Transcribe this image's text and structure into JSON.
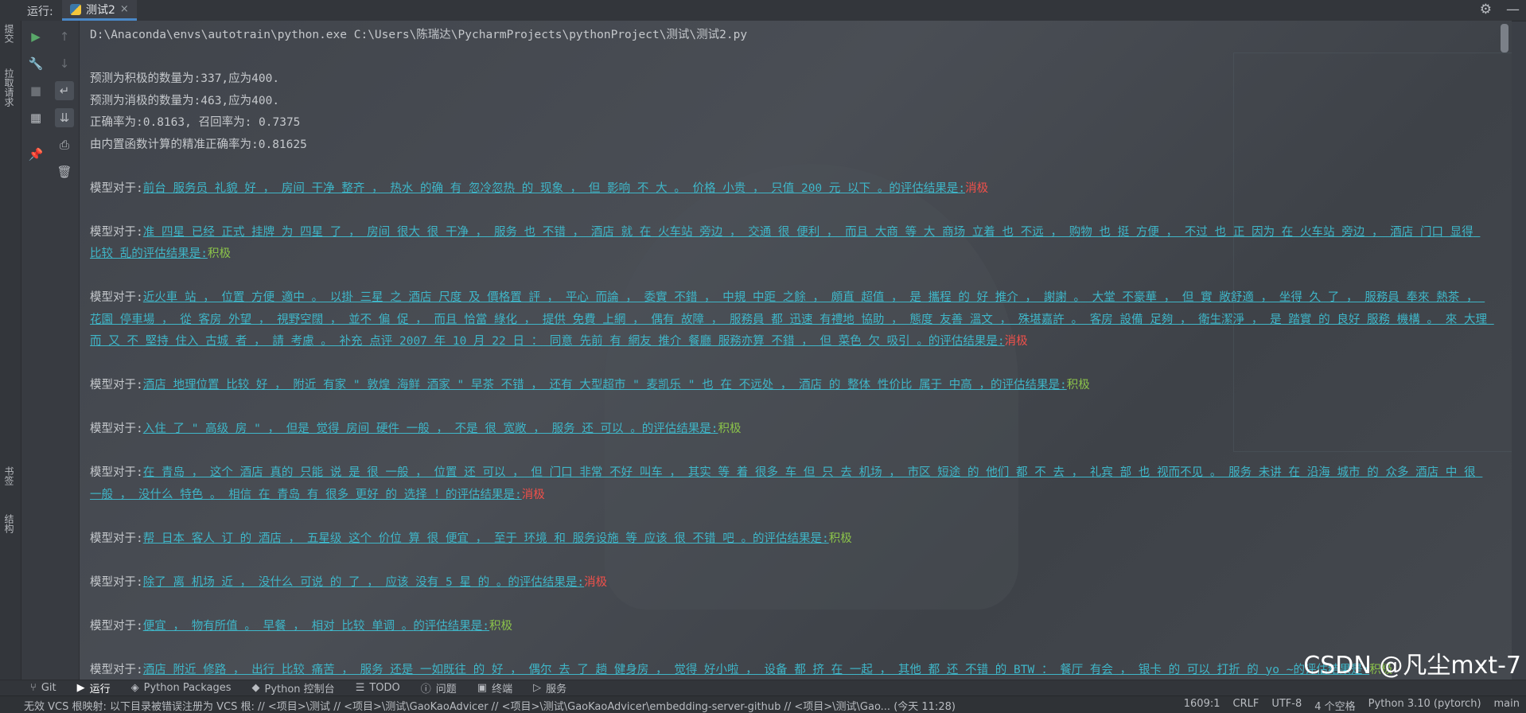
{
  "topbar": {
    "run_label": "运行:",
    "tab_label": "测试2",
    "tab_close": "×",
    "settings_icon": "gear-icon",
    "minimize_icon": "—"
  },
  "left_vertical_tabs": {
    "commit": "提交",
    "pull_requests": "拉取请求",
    "bookmarks": "书签",
    "structure": "结构"
  },
  "runbar_icons": [
    "play-icon",
    "up-arrow-icon",
    "wrench-icon",
    "down-arrow-icon",
    "stop-icon",
    "soft-wrap-icon",
    "layout-icon",
    "scroll-end-icon",
    "print-icon",
    "pin-icon",
    "trash-icon"
  ],
  "console": {
    "command": "D:\\Anaconda\\envs\\autotrain\\python.exe C:\\Users\\陈瑞达\\PycharmProjects\\pythonProject\\测试\\测试2.py",
    "stats": [
      "预测为积极的数量为:337,应为400.",
      "预测为消极的数量为:463,应为400.",
      "正确率为:0.8163, 召回率为: 0.7375",
      "由内置函数计算的精准正确率为:0.81625"
    ],
    "prefix": "模型对于:",
    "suffix": "的评估结果是:",
    "entries": [
      {
        "text": "前台 服务员 礼貌 好 ， 房间 干净 整齐 ， 热水 的确 有 忽冷忽热 的 现象 ， 但 影响 不 大 。 价格 小贵 ， 只值 200 元 以下 。",
        "result": "消极"
      },
      {
        "text": "准 四星 已经 正式 挂牌 为 四星 了 ， 房间 很大 很 干净 ， 服务 也 不错 ， 酒店 就 在 火车站 旁边 ， 交通 很 便利 ， 而且 大商 等 大 商场 立着 也 不远 ， 购物 也 挺 方便 ， 不过 也 正 因为 在 火车站 旁边 ， 酒店 门口 显得 比较 乱",
        "result": "积极"
      },
      {
        "text": "近火車 站 ， 位置 方便 適中 。 以掛 三星 之 酒店 尺度 及 價格置 評 ， 平心 而論 ， 委實 不錯 ， 中規 中距 之餘 ， 頗直 超值 ， 是 攜程 的 好 推介 ， 謝謝 。 大堂 不豪華 ， 但 實 敞舒適 ， 坐得 久 了 ， 服務員 奉來 熱茶 ， 花園 停車場 ， 從 客房 外望 ， 視野空闊 ， 並不 偏 促 ， 而且 恰當 綠化 ， 提供 免費 上網 ， 偶有 故障 ， 服務員 都 迅速 有禮地 協助 ， 態度 友善 溫文 ， 殊堪嘉許 。 客房 設備 足夠 ， 衛生潔淨 ， 是 踏實 的 良好 服務 機構 。 來 大理 而 又 不 堅持 住入 古城 者 ， 請 考慮 。 补充 点评 2007 年 10 月 22 日 ： 同意 先前 有 網友 推介 餐廳 服務亦算 不錯 ， 但 菜色 欠 吸引 。",
        "result": "消极"
      },
      {
        "text": "酒店 地理位置 比较 好 ， 附近 有家 \" 敦煌 海鲜 酒家 \" 早茶 不错 ， 还有 大型超市 \" 麦凯乐 \" 也 在 不远处 ， 酒店 的 整体 性价比 属于 中高 ，",
        "result": "积极"
      },
      {
        "text": "入住 了 \" 高级 房 \" ， 但是 觉得 房间 硬件 一般 ， 不是 很 宽敞 ， 服务 还 可以 。",
        "result": "积极"
      },
      {
        "text": "在 青岛 ， 这个 酒店 真的 只能 说 是 很 一般 ， 位置 还 可以 ， 但 门口 非常 不好 叫车 ， 其实 等 着 很多 车 但 只 去 机场 ， 市区 短途 的 他们 都 不 去 ， 礼宾 部 也 视而不见 。 服务 未讲 在 沿海 城市 的 众多 酒店 中 很 一般 ， 没什么 特色 。 相信 在 青岛 有 很多 更好 的 选择 ！",
        "result": "消极"
      },
      {
        "text": "帮 日本 客人 订 的 酒店 ， 五星级 这个 价位 算 很 便宜 ， 至于 环境 和 服务设施 等 应该 很 不错 吧 。",
        "result": "积极"
      },
      {
        "text": "除了 离 机场 近 ， 没什么 可说 的 了 ， 应该 没有 5 星 的 。",
        "result": "消极"
      },
      {
        "text": "便宜 ， 物有所值 。 早餐 ， 相对 比较 单调 。",
        "result": "积极"
      },
      {
        "text": "酒店 附近 修路 ， 出行 比较 痛苦 ， 服务 还是 一如既往 的 好 ， 偶尔 去 了 趟 健身房 ， 觉得 好小啦 ， 设备 都 挤 在 一起 ， 其他 都 还 不错 的 BTW ： 餐厅 有会 ， 银卡 的 可以 打折 的 yo ~",
        "result": "积极"
      }
    ]
  },
  "bottom_tabs": [
    "Git",
    "运行",
    "Python Packages",
    "Python 控制台",
    "TODO",
    "问题",
    "终端",
    "服务"
  ],
  "status": {
    "message": "无效 VCS 根映射: 以下目录被错误注册为 VCS 根: // <项目>\\测试 // <项目>\\测试\\GaoKaoAdvicer // <项目>\\测试\\GaoKaoAdvicer\\embedding-server-github // <项目>\\测试\\Gao... (今天 11:28)",
    "position": "1609:1",
    "line_sep": "CRLF",
    "encoding": "UTF-8",
    "indent": "4 个空格",
    "interpreter": "Python 3.10 (pytorch)",
    "branch": "main"
  },
  "watermark": "CSDN @凡尘mxt-7"
}
